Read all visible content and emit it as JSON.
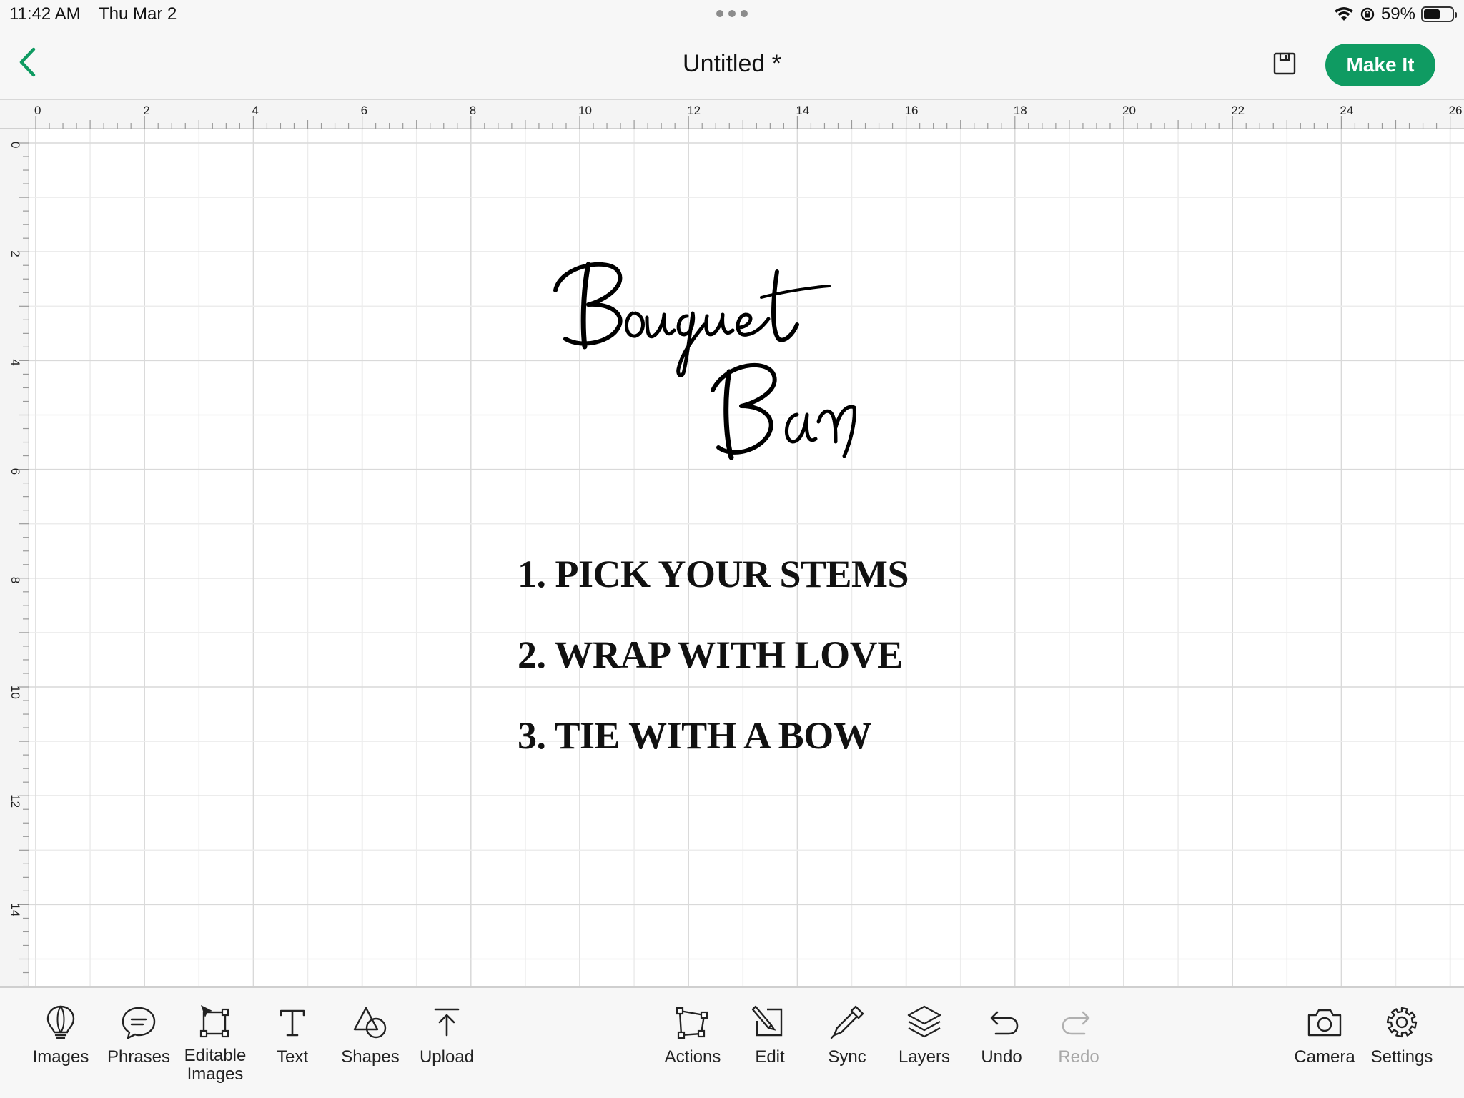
{
  "status_bar": {
    "time": "11:42 AM",
    "date": "Thu Mar 2",
    "battery": "59%",
    "battery_level": 0.59
  },
  "header": {
    "title": "Untitled *",
    "make_it_label": "Make It",
    "accent_color": "#0f9b62"
  },
  "rulers": {
    "horizontal_labels": [
      "0",
      "2",
      "4",
      "6",
      "8",
      "10",
      "12",
      "14",
      "16",
      "18",
      "20",
      "22",
      "24",
      "26"
    ],
    "vertical_labels": [
      "0",
      "2",
      "4",
      "6",
      "8",
      "10",
      "12",
      "14"
    ]
  },
  "canvas": {
    "design_title": "Bouquet Bar",
    "steps": [
      "1. PICK YOUR STEMS",
      "2. WRAP WITH LOVE",
      "3. TIE WITH A BOW"
    ]
  },
  "toolbar": {
    "left": [
      {
        "name": "images",
        "label": "Images",
        "icon": "lightbulb-icon"
      },
      {
        "name": "phrases",
        "label": "Phrases",
        "icon": "speech-bubble-icon"
      },
      {
        "name": "editable-images",
        "label": "Editable Images",
        "icon": "editable-images-icon"
      },
      {
        "name": "text",
        "label": "Text",
        "icon": "text-t-icon"
      },
      {
        "name": "shapes",
        "label": "Shapes",
        "icon": "shapes-icon"
      },
      {
        "name": "upload",
        "label": "Upload",
        "icon": "upload-arrow-icon"
      }
    ],
    "middle": [
      {
        "name": "actions",
        "label": "Actions",
        "icon": "actions-icon"
      },
      {
        "name": "edit",
        "label": "Edit",
        "icon": "edit-icon"
      },
      {
        "name": "sync",
        "label": "Sync",
        "icon": "eyedropper-icon"
      },
      {
        "name": "layers",
        "label": "Layers",
        "icon": "layers-icon"
      },
      {
        "name": "undo",
        "label": "Undo",
        "icon": "undo-icon"
      },
      {
        "name": "redo",
        "label": "Redo",
        "icon": "redo-icon",
        "disabled": true
      }
    ],
    "right": [
      {
        "name": "camera",
        "label": "Camera",
        "icon": "camera-icon"
      },
      {
        "name": "settings",
        "label": "Settings",
        "icon": "gear-icon"
      }
    ]
  }
}
